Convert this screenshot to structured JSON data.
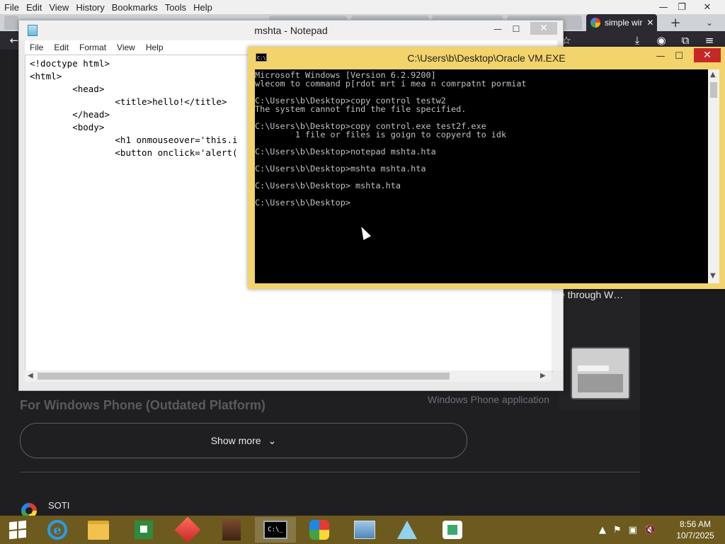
{
  "browser": {
    "menubar": [
      "File",
      "Edit",
      "View",
      "History",
      "Bookmarks",
      "Tools",
      "Help"
    ],
    "active_tab_title": "simple wir",
    "page": {
      "snippet_text": "e through W…",
      "app_caption": "Windows Phone application",
      "section_heading": "For Windows Phone (Outdated Platform)",
      "show_more_label": "Show more",
      "result_title": "SOTI"
    },
    "colors": {
      "page_bg": "#1f1f22",
      "toolbar_bg": "#2b2a33"
    }
  },
  "notepad": {
    "title": "mshta - Notepad",
    "menu": [
      "File",
      "Edit",
      "Format",
      "View",
      "Help"
    ],
    "content": "<!doctype html>\n<html>\n        <head>\n                <title>hello!</title>\n        </head>\n        <body>\n                <h1 onmouseover='this.i\n                <button onclick='alert("
  },
  "console": {
    "title": "C:\\Users\\b\\Desktop\\Oracle VM.EXE",
    "content": "Microsoft Windows [Version 6.2.9200]\nwlecom to command p[rdot mrt i mea n comrpatnt pormiat\n\nC:\\Users\\b\\Desktop>copy control testw2\nThe system cannot find the file specified.\n\nC:\\Users\\b\\Desktop>copy control.exe test2f.exe\n        1 file or files is goign to copyerd to idk\n\nC:\\Users\\b\\Desktop>notepad mshta.hta\n\nC:\\Users\\b\\Desktop>mshta mshta.hta\n\nC:\\Users\\b\\Desktop> mshta.hta\n\nC:\\Users\\b\\Desktop>",
    "colors": {
      "frame": "#f3d36b",
      "screen": "#000000",
      "text": "#c0c0c0",
      "close": "#c62828"
    }
  },
  "taskbar": {
    "apps": [
      "internet-explorer",
      "file-explorer",
      "store",
      "cube-app",
      "figure-app",
      "command-prompt",
      "colors-app",
      "network-app",
      "prism-app",
      "house-app"
    ],
    "clock_time": "8:56 AM",
    "clock_date": "10/7/2025",
    "colors": {
      "bg": "#6d5a1f"
    }
  }
}
